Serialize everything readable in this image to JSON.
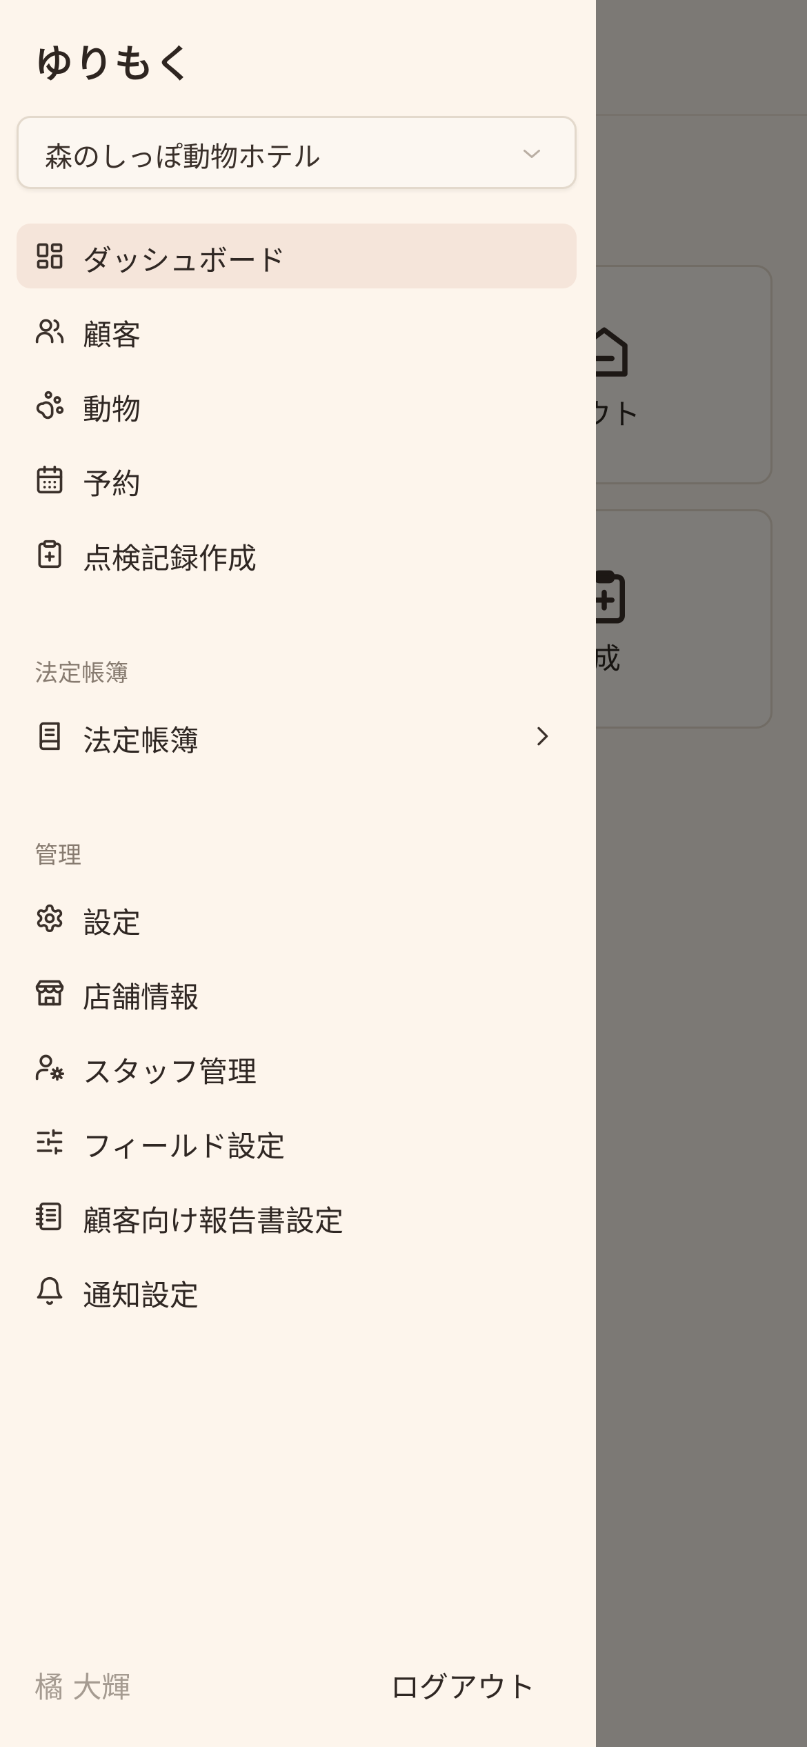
{
  "background": {
    "card1_label": "ン/アウト",
    "card2_label": "録作成"
  },
  "drawer": {
    "brand": "ゆりもく",
    "store_select": {
      "value": "森のしっぽ動物ホテル"
    },
    "main_nav": [
      {
        "label": "ダッシュボード",
        "icon": "dashboard-icon",
        "active": true
      },
      {
        "label": "顧客",
        "icon": "users-icon"
      },
      {
        "label": "動物",
        "icon": "paw-icon"
      },
      {
        "label": "予約",
        "icon": "calendar-icon"
      },
      {
        "label": "点検記録作成",
        "icon": "clipboard-plus-icon"
      }
    ],
    "ledger_section": {
      "title": "法定帳簿",
      "items": [
        {
          "label": "法定帳簿",
          "icon": "book-icon"
        }
      ]
    },
    "admin_section": {
      "title": "管理",
      "items": [
        {
          "label": "設定",
          "icon": "gear-icon"
        },
        {
          "label": "店舗情報",
          "icon": "store-icon"
        },
        {
          "label": "スタッフ管理",
          "icon": "user-cog-icon"
        },
        {
          "label": "フィールド設定",
          "icon": "sliders-icon"
        },
        {
          "label": "顧客向け報告書設定",
          "icon": "notebook-icon"
        },
        {
          "label": "通知設定",
          "icon": "bell-icon"
        }
      ]
    },
    "footer": {
      "user_name": "橘 大輝",
      "logout_label": "ログアウト"
    }
  },
  "colors": {
    "drawer_bg": "#fdf5ec",
    "active_bg": "#f5e5da",
    "text": "#2f2723",
    "muted": "#877b70",
    "overlay": "rgba(0,0,0,0.5)"
  }
}
